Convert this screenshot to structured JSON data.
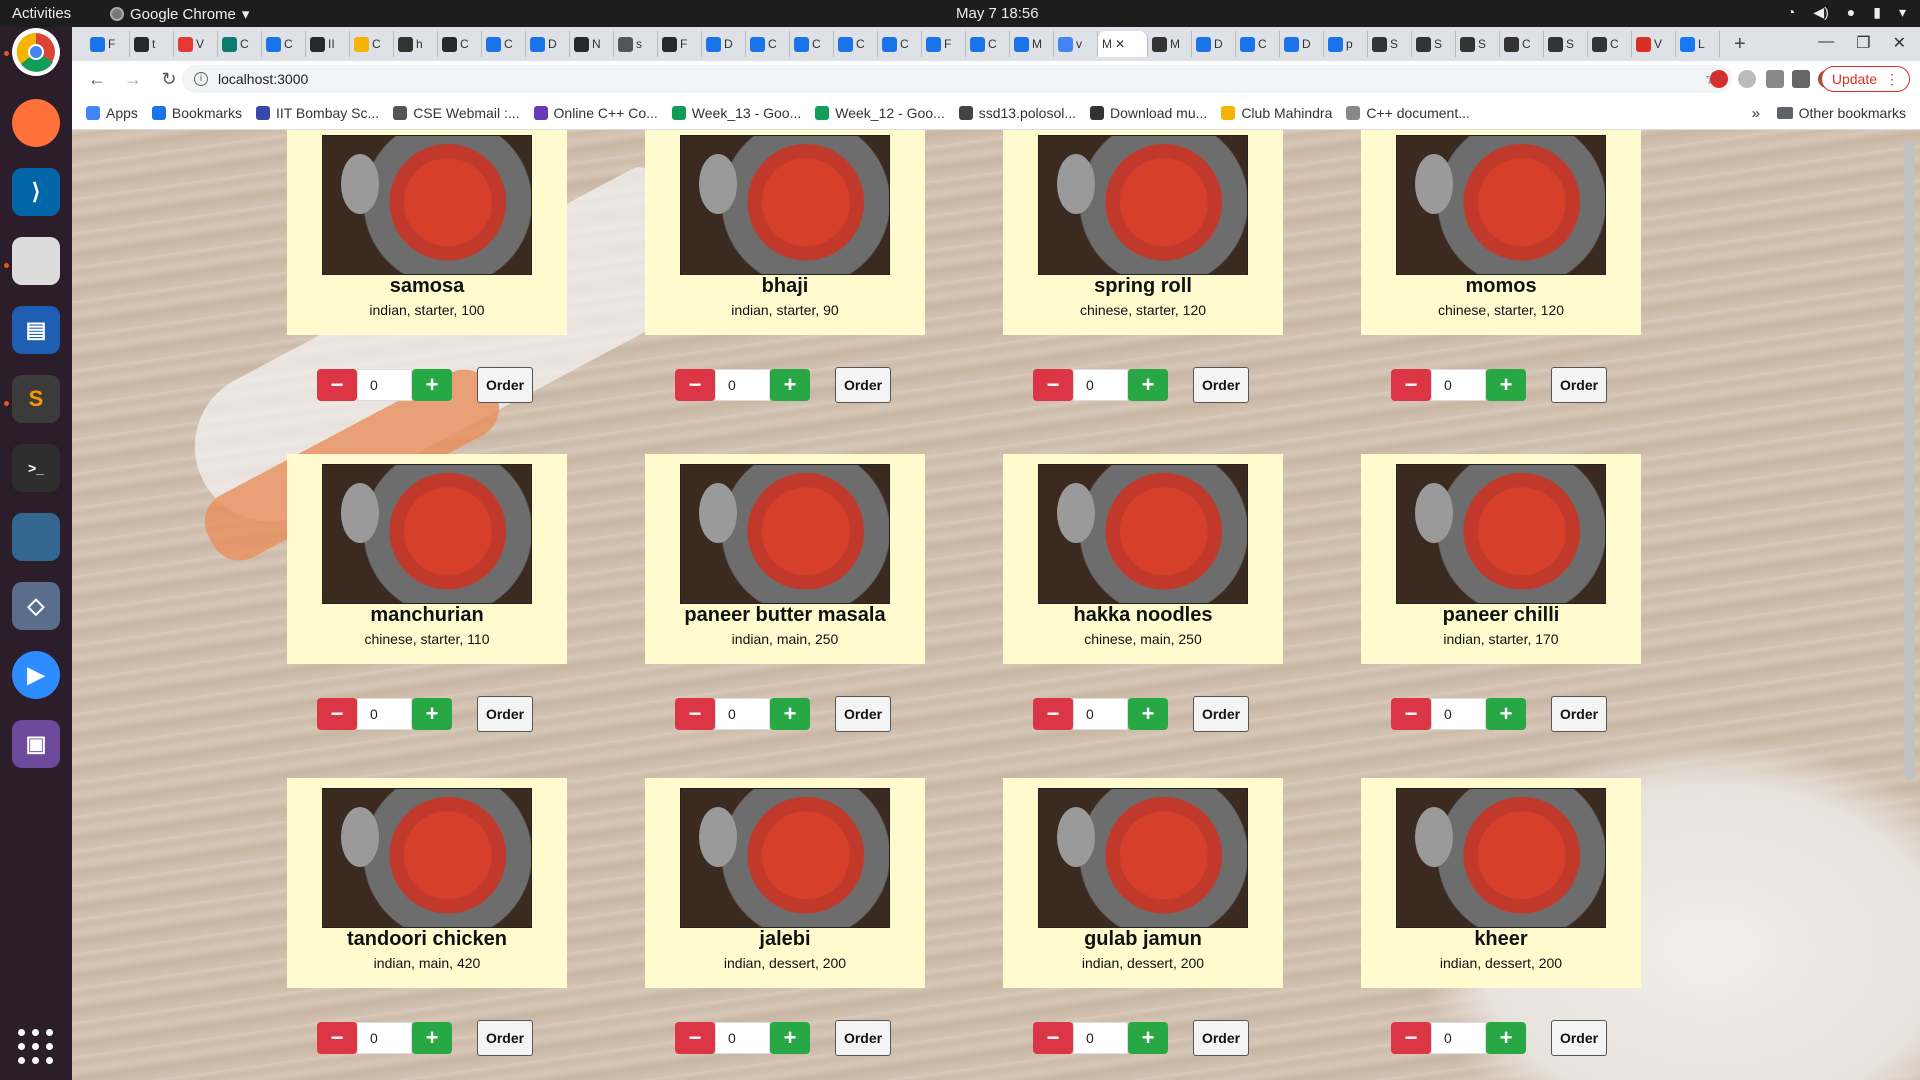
{
  "system": {
    "activities": "Activities",
    "app_name": "Google Chrome",
    "clock": "May 7  18:56"
  },
  "browser": {
    "url": "localhost:3000",
    "update_label": "Update",
    "tabs": [
      "F",
      "t",
      "V",
      "C",
      "C",
      "II",
      "C",
      "h",
      "C",
      "C",
      "D",
      "N",
      "s",
      "F",
      "D",
      "C",
      "C",
      "C",
      "C",
      "F",
      "C",
      "M",
      "v",
      "M",
      "D",
      "C",
      "D",
      "p",
      "S",
      "S",
      "S",
      "C",
      "S",
      "C",
      "V",
      "L"
    ],
    "active_tab": "M",
    "bookmarks": [
      "Apps",
      "Bookmarks",
      "IIT Bombay Sc...",
      "CSE Webmail :...",
      "Online C++ Co...",
      "Week_13 - Goo...",
      "Week_12 - Goo...",
      "ssd13.polosol...",
      "Download mu...",
      "Club Mahindra",
      "C++ document..."
    ],
    "other_bookmarks": "Other bookmarks"
  },
  "menu": {
    "order_label": "Order",
    "minus_label": "−",
    "plus_label": "+",
    "items": [
      {
        "name": "samosa",
        "meta": "indian, starter, 100",
        "qty": "0"
      },
      {
        "name": "bhaji",
        "meta": "indian, starter, 90",
        "qty": "0"
      },
      {
        "name": "spring roll",
        "meta": "chinese, starter, 120",
        "qty": "0"
      },
      {
        "name": "momos",
        "meta": "chinese, starter, 120",
        "qty": "0"
      },
      {
        "name": "manchurian",
        "meta": "chinese, starter, 110",
        "qty": "0"
      },
      {
        "name": "paneer butter masala",
        "meta": "indian, main, 250",
        "qty": "0"
      },
      {
        "name": "hakka noodles",
        "meta": "chinese, main, 250",
        "qty": "0"
      },
      {
        "name": "paneer chilli",
        "meta": "indian, starter, 170",
        "qty": "0"
      },
      {
        "name": "tandoori chicken",
        "meta": "indian, main, 420",
        "qty": "0"
      },
      {
        "name": "jalebi",
        "meta": "indian, dessert, 200",
        "qty": "0"
      },
      {
        "name": "gulab jamun",
        "meta": "indian, dessert, 200",
        "qty": "0"
      },
      {
        "name": "kheer",
        "meta": "indian, dessert, 200",
        "qty": "0"
      }
    ]
  }
}
